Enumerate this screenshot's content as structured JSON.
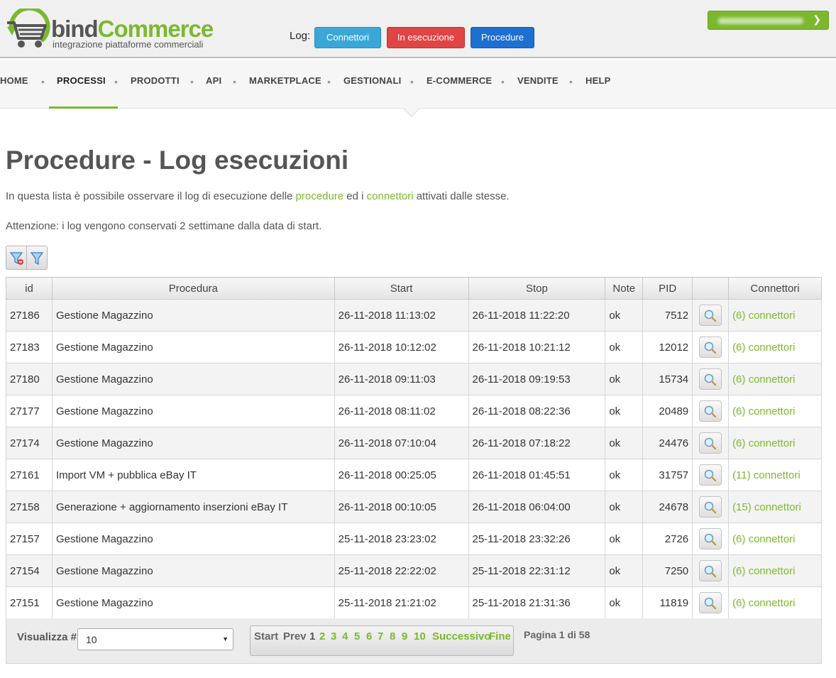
{
  "header": {
    "logo_brand_part1": "bind",
    "logo_brand_part2": "Commerce",
    "logo_tagline": "integrazione piattaforme commerciali",
    "log_label": "Log:",
    "log_buttons": [
      "Connettori",
      "In esecuzione",
      "Procedure"
    ],
    "user_menu_icon": "chevron-down-icon"
  },
  "nav": {
    "items": [
      "HOME",
      "PROCESSI",
      "PRODOTTI",
      "API",
      "MARKETPLACE",
      "GESTIONALI",
      "E-COMMERCE",
      "VENDITE",
      "HELP"
    ],
    "active": "PROCESSI",
    "separator": "•"
  },
  "page": {
    "title": "Procedure - Log esecuzioni",
    "desc_before": "In questa lista è possibile osservare il log di esecuzione delle ",
    "desc_link1": "procedure",
    "desc_middle": " ed i ",
    "desc_link2": "connettori",
    "desc_after": " attivati dalle stesse.",
    "note": "Attenzione: i log vengono conservati 2 settimane dalla data di start."
  },
  "filters": {
    "icons": [
      "filter-clear-icon",
      "filter-icon"
    ]
  },
  "table": {
    "columns": [
      "id",
      "Procedura",
      "Start",
      "Stop",
      "Note",
      "PID",
      "",
      "Connettori"
    ],
    "rows": [
      {
        "id": "27186",
        "procedura": "Gestione Magazzino",
        "start": "26-11-2018 11:13:02",
        "stop": "26-11-2018 11:22:20",
        "note": "ok",
        "pid": "7512",
        "connettori": "(6) connettori"
      },
      {
        "id": "27183",
        "procedura": "Gestione Magazzino",
        "start": "26-11-2018 10:12:02",
        "stop": "26-11-2018 10:21:12",
        "note": "ok",
        "pid": "12012",
        "connettori": "(6) connettori"
      },
      {
        "id": "27180",
        "procedura": "Gestione Magazzino",
        "start": "26-11-2018 09:11:03",
        "stop": "26-11-2018 09:19:53",
        "note": "ok",
        "pid": "15734",
        "connettori": "(6) connettori"
      },
      {
        "id": "27177",
        "procedura": "Gestione Magazzino",
        "start": "26-11-2018 08:11:02",
        "stop": "26-11-2018 08:22:36",
        "note": "ok",
        "pid": "20489",
        "connettori": "(6) connettori"
      },
      {
        "id": "27174",
        "procedura": "Gestione Magazzino",
        "start": "26-11-2018 07:10:04",
        "stop": "26-11-2018 07:18:22",
        "note": "ok",
        "pid": "24476",
        "connettori": "(6) connettori"
      },
      {
        "id": "27161",
        "procedura": "Import VM + pubblica eBay IT",
        "start": "26-11-2018 00:25:05",
        "stop": "26-11-2018 01:45:51",
        "note": "ok",
        "pid": "31757",
        "connettori": "(11) connettori"
      },
      {
        "id": "27158",
        "procedura": "Generazione + aggiornamento inserzioni eBay IT",
        "start": "26-11-2018 00:10:05",
        "stop": "26-11-2018 06:04:00",
        "note": "ok",
        "pid": "24678",
        "connettori": "(15) connettori"
      },
      {
        "id": "27157",
        "procedura": "Gestione Magazzino",
        "start": "25-11-2018 23:23:02",
        "stop": "25-11-2018 23:32:26",
        "note": "ok",
        "pid": "2726",
        "connettori": "(6) connettori"
      },
      {
        "id": "27154",
        "procedura": "Gestione Magazzino",
        "start": "25-11-2018 22:22:02",
        "stop": "25-11-2018 22:31:12",
        "note": "ok",
        "pid": "7250",
        "connettori": "(6) connettori"
      },
      {
        "id": "27151",
        "procedura": "Gestione Magazzino",
        "start": "25-11-2018 21:21:02",
        "stop": "25-11-2018 21:31:36",
        "note": "ok",
        "pid": "11819",
        "connettori": "(6) connettori"
      }
    ],
    "view_icon": "magnifier-icon"
  },
  "footer": {
    "visualizza_label": "Visualizza #",
    "page_size": "10",
    "pager": {
      "start": "Start",
      "prev": "Prev",
      "pages": [
        "1",
        "2",
        "3",
        "4",
        "5",
        "6",
        "7",
        "8",
        "9",
        "10"
      ],
      "current": "1",
      "next": "Successivo",
      "end": "Fine"
    },
    "page_info": "Pagina 1 di 58"
  },
  "colors": {
    "brand_green": "#7cb82f",
    "btn_connettori": "#3aa7d9",
    "btn_in_esecuzione": "#e04444",
    "btn_procedure": "#1e6fd2"
  }
}
